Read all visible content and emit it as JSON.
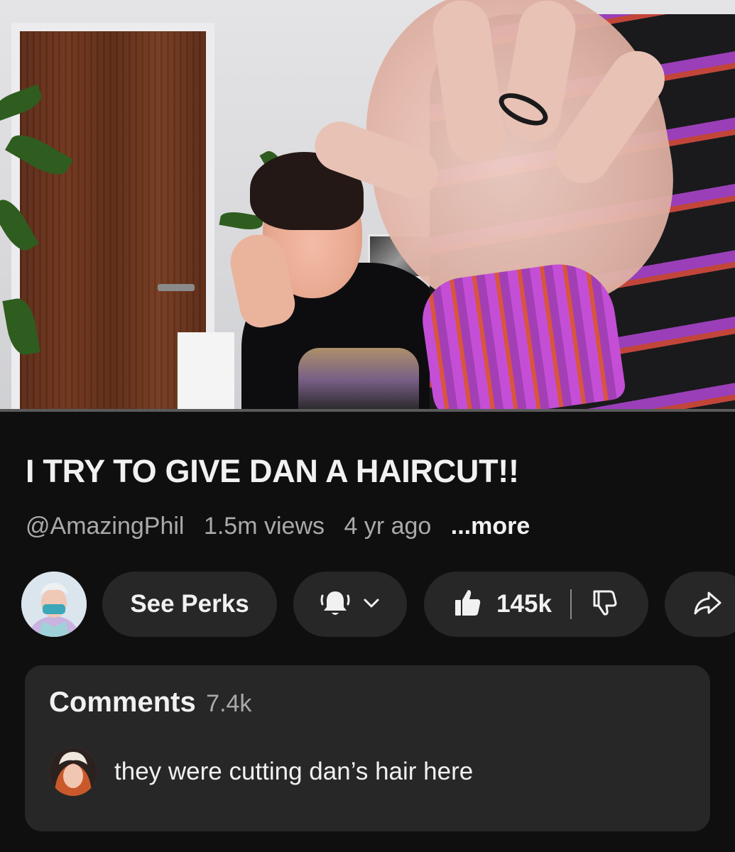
{
  "video": {
    "title": "I TRY TO GIVE DAN A HAIRCUT!!",
    "channel_handle": "@AmazingPhil",
    "views": "1.5m views",
    "age": "4 yr ago",
    "more_label": "...more"
  },
  "actions": {
    "see_perks_label": "See Perks",
    "likes": "145k"
  },
  "comments": {
    "heading": "Comments",
    "count": "7.4k",
    "top_comment_text": "they were cutting dan’s hair here"
  },
  "icons": {
    "bell": "bell-icon",
    "chevron": "chevron-down-icon",
    "like": "thumbs-up-icon",
    "dislike": "thumbs-down-icon",
    "share": "share-icon"
  },
  "colors": {
    "background": "#0f0f0f",
    "surface": "#272727",
    "text_primary": "#f1f1f1",
    "text_secondary": "#aaaaaa"
  }
}
